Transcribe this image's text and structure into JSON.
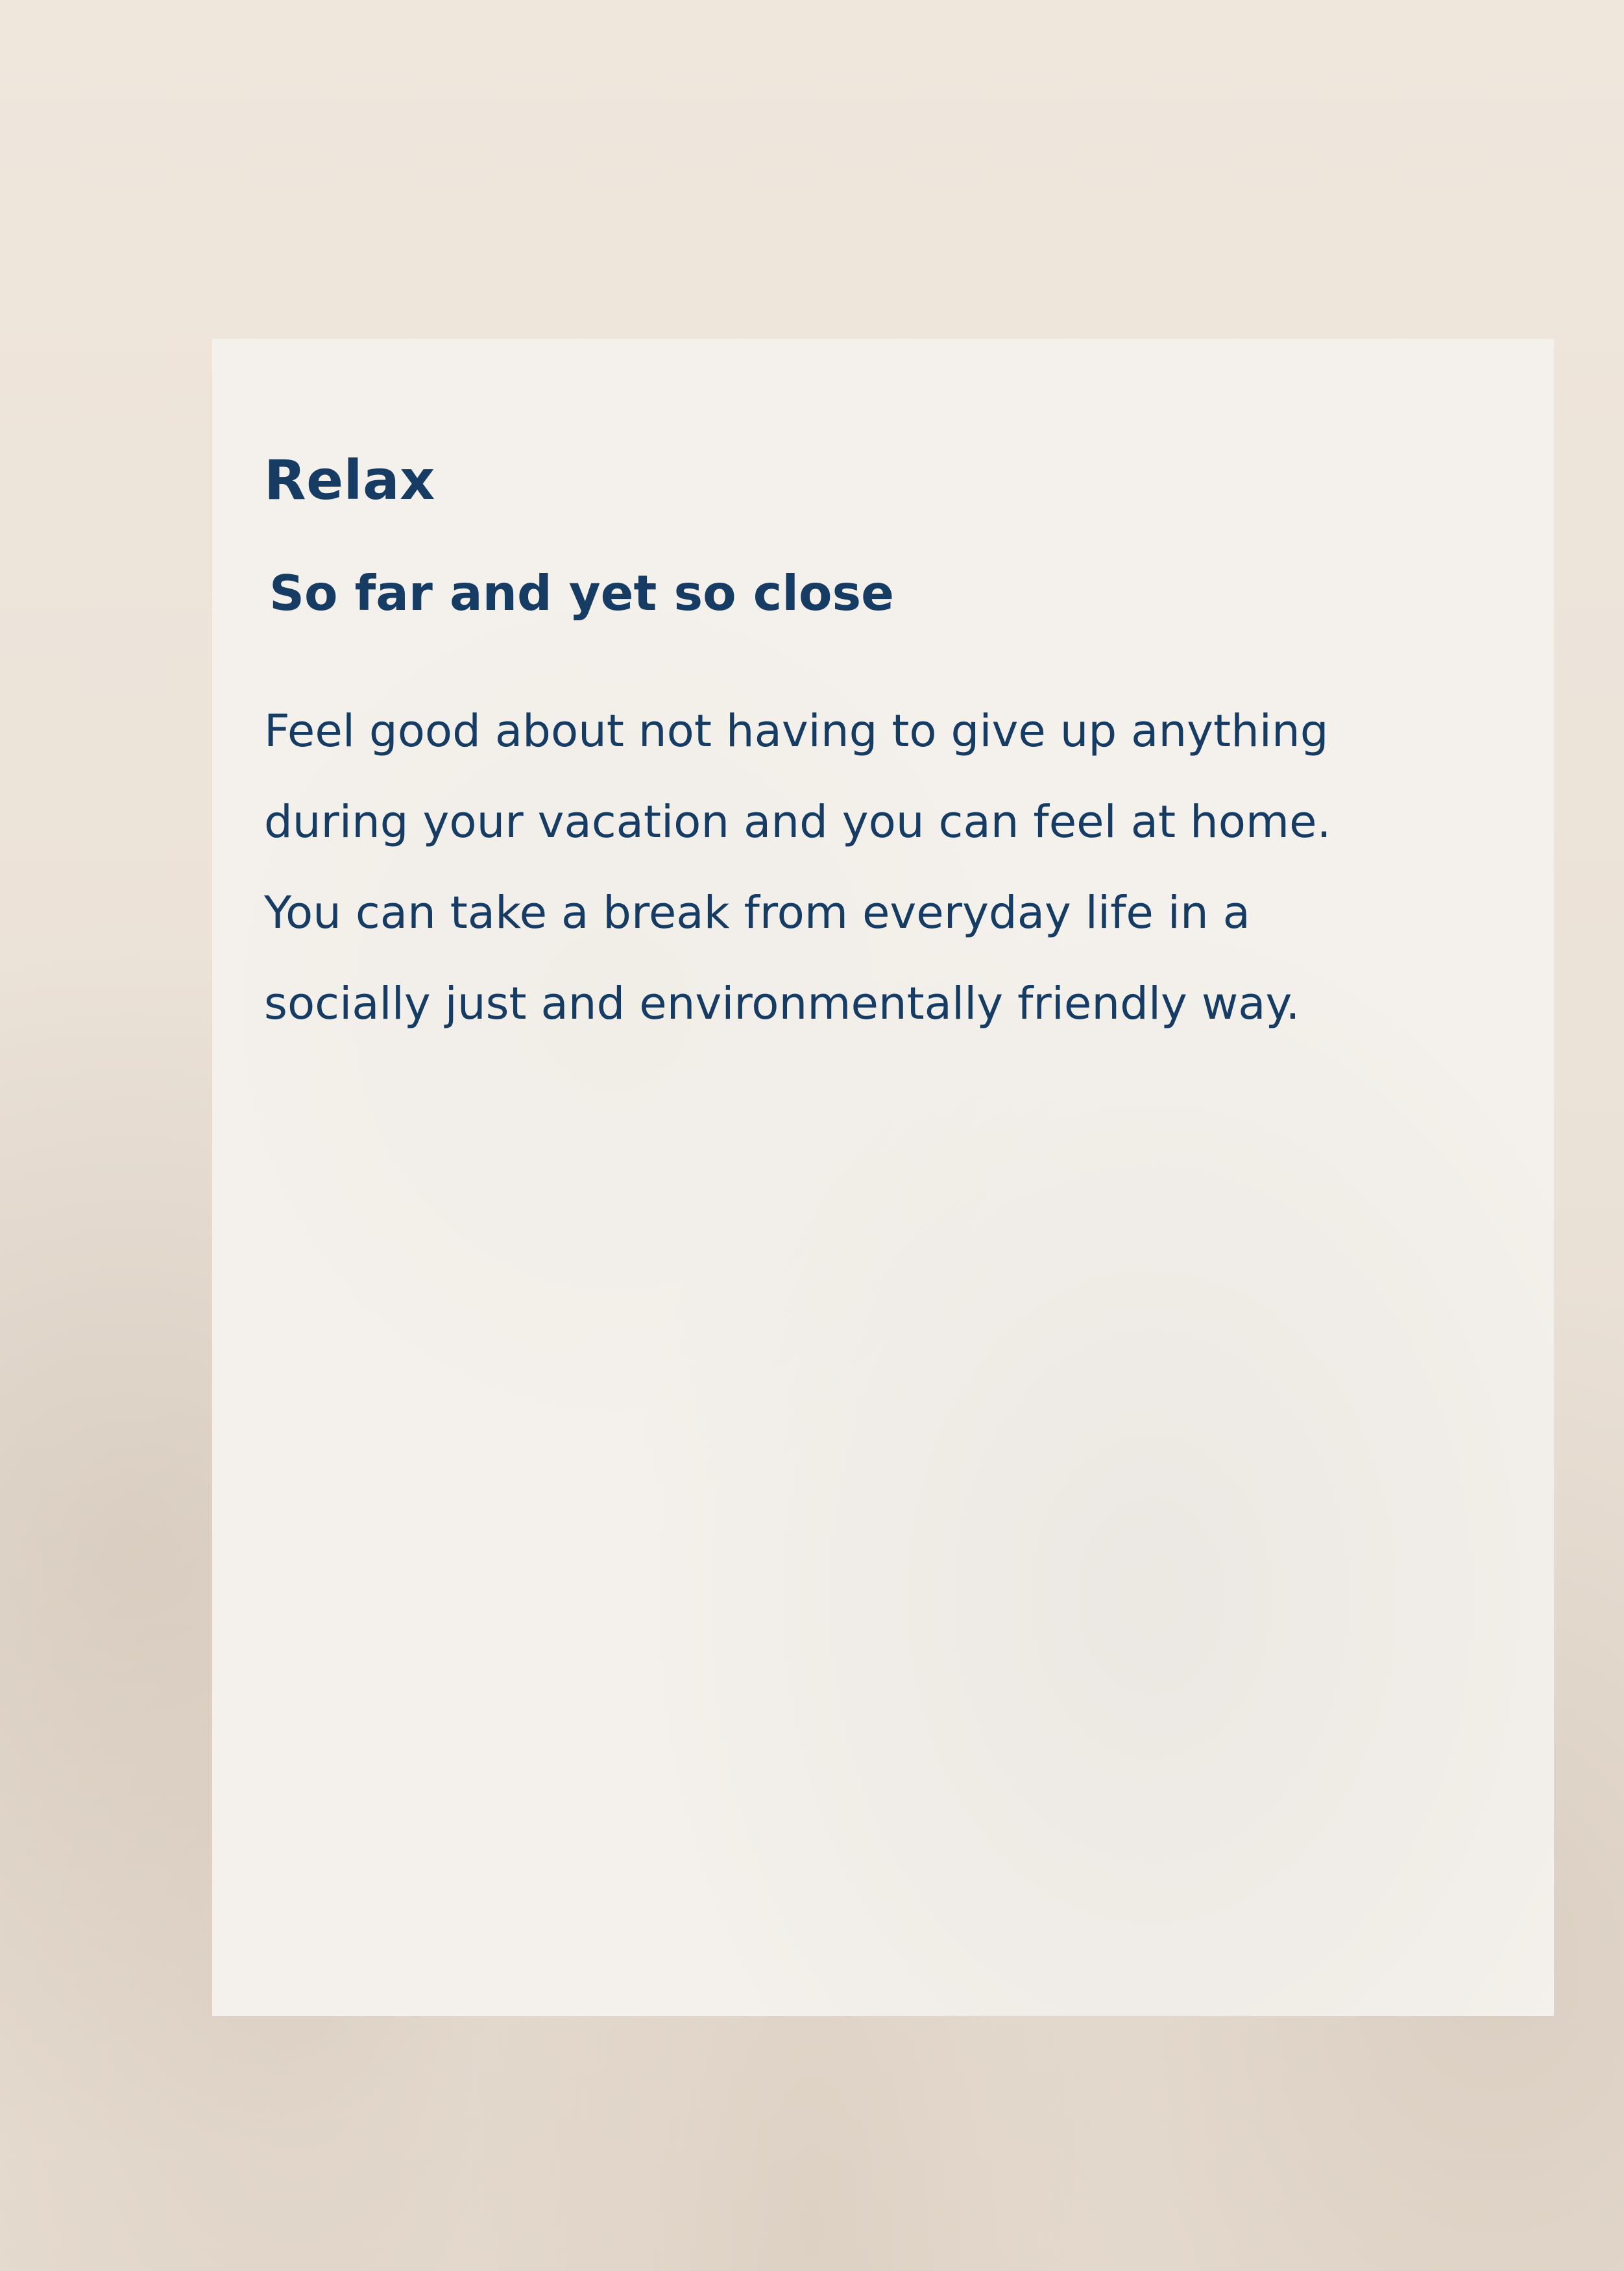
{
  "card": {
    "title": "Relax",
    "subtitle": "So far and yet so close",
    "body_lines": [
      "Feel good about not having to give up anything",
      "during your vacation and you can feel at home.",
      "You can take a break from everyday life in a",
      "socially just and environmentally friendly way."
    ]
  },
  "colors": {
    "text": "#163c64",
    "background": "#ebe2d8",
    "card": "#f4f1ec"
  }
}
